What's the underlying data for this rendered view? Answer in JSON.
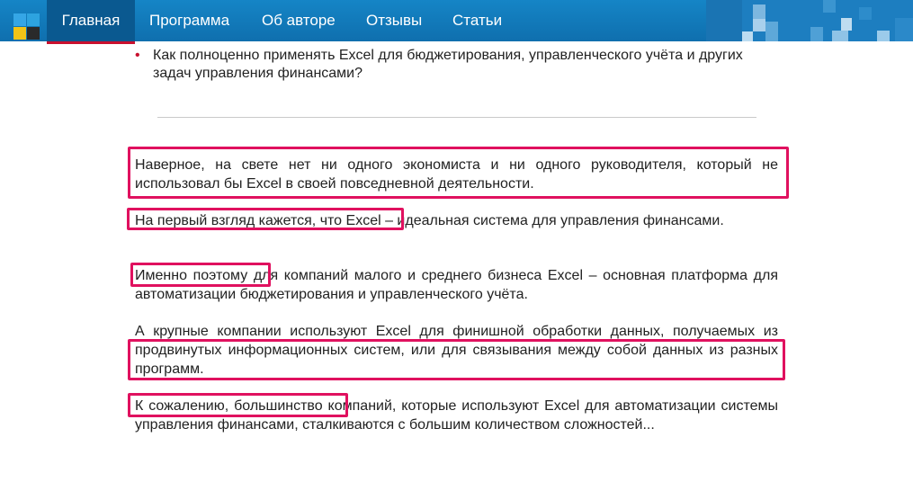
{
  "nav": {
    "items": [
      "Главная",
      "Программа",
      "Об авторе",
      "Отзывы",
      "Статьи"
    ],
    "active_index": 0,
    "accent_color": "#c8102e",
    "bar_color": "#1585c6"
  },
  "bullet_text": "Как полноценно применять Excel для бюджетирования, управленческого учёта и других задач управления финансами?",
  "paragraphs": [
    "Наверное, на свете нет ни одного экономиста и ни одного руководителя, который не использовал бы Excel в своей повседневной деятельности.",
    "На первый взгляд кажется, что Excel – идеальная система для управления финансами.",
    "Именно поэтому для компаний малого и среднего бизнеса Excel – основная платформа для автоматизации бюджетирования и управленческого учёта.",
    "А крупные компании используют Excel для финишной обработки данных, получаемых из продвинутых информационных систем, или для связывания между собой данных из разных программ.",
    "К сожалению, большинство компаний, которые используют Excel для автоматизации системы управления финансами, сталкиваются с большим количеством сложностей..."
  ],
  "highlight_color": "#e0115f"
}
